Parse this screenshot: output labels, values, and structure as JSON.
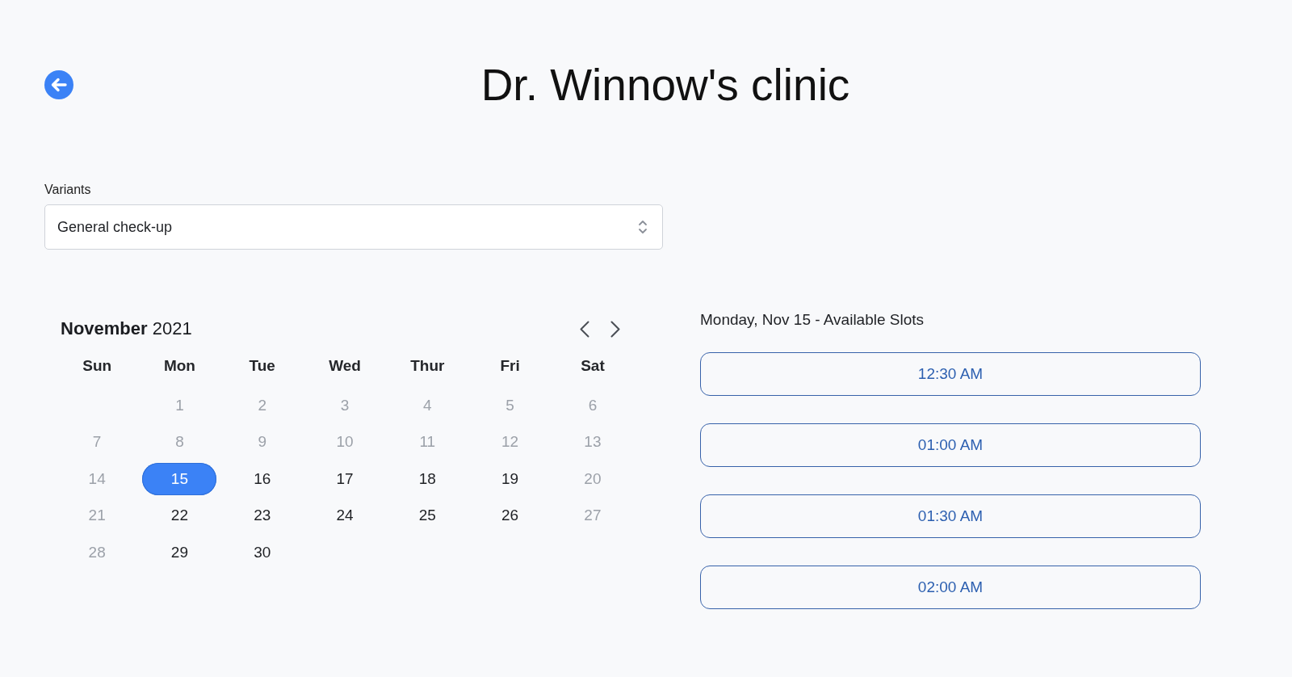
{
  "title": "Dr. Winnow's clinic",
  "variants": {
    "label": "Variants",
    "value": "General check-up"
  },
  "calendar": {
    "heading": "**November** 2021",
    "weekdays": [
      "Sun",
      "Mon",
      "Tue",
      "Wed",
      "Thur",
      "Fri",
      "Sat"
    ],
    "weeks": [
      {
        "right_aligned": true,
        "days": [
          {
            "day": "1",
            "disabled": true,
            "selected": false
          },
          {
            "day": "2",
            "disabled": true,
            "selected": false
          },
          {
            "day": "3",
            "disabled": true,
            "selected": false
          },
          {
            "day": "4",
            "disabled": true,
            "selected": false
          },
          {
            "day": "5",
            "disabled": true,
            "selected": false
          },
          {
            "day": "6",
            "disabled": true,
            "selected": false
          }
        ]
      },
      {
        "right_aligned": false,
        "days": [
          {
            "day": "7",
            "disabled": true,
            "selected": false
          },
          {
            "day": "8",
            "disabled": true,
            "selected": false
          },
          {
            "day": "9",
            "disabled": true,
            "selected": false
          },
          {
            "day": "10",
            "disabled": true,
            "selected": false
          },
          {
            "day": "11",
            "disabled": true,
            "selected": false
          },
          {
            "day": "12",
            "disabled": true,
            "selected": false
          },
          {
            "day": "13",
            "disabled": true,
            "selected": false
          }
        ]
      },
      {
        "right_aligned": false,
        "days": [
          {
            "day": "14",
            "disabled": true,
            "selected": false
          },
          {
            "day": "15",
            "disabled": false,
            "selected": true
          },
          {
            "day": "16",
            "disabled": false,
            "selected": false
          },
          {
            "day": "17",
            "disabled": false,
            "selected": false
          },
          {
            "day": "18",
            "disabled": false,
            "selected": false
          },
          {
            "day": "19",
            "disabled": false,
            "selected": false
          },
          {
            "day": "20",
            "disabled": true,
            "selected": false
          }
        ]
      },
      {
        "right_aligned": false,
        "days": [
          {
            "day": "21",
            "disabled": true,
            "selected": false
          },
          {
            "day": "22",
            "disabled": false,
            "selected": false
          },
          {
            "day": "23",
            "disabled": false,
            "selected": false
          },
          {
            "day": "24",
            "disabled": false,
            "selected": false
          },
          {
            "day": "25",
            "disabled": false,
            "selected": false
          },
          {
            "day": "26",
            "disabled": false,
            "selected": false
          },
          {
            "day": "27",
            "disabled": true,
            "selected": false
          }
        ]
      },
      {
        "right_aligned": false,
        "days": [
          {
            "day": "28",
            "disabled": true,
            "selected": false
          },
          {
            "day": "29",
            "disabled": false,
            "selected": false
          },
          {
            "day": "30",
            "disabled": false,
            "selected": false
          }
        ]
      }
    ]
  },
  "slots": {
    "heading": "Monday, Nov 15 - Available Slots",
    "times": [
      "12:30 AM",
      "01:00 AM",
      "01:30 AM",
      "02:00 AM"
    ]
  }
}
